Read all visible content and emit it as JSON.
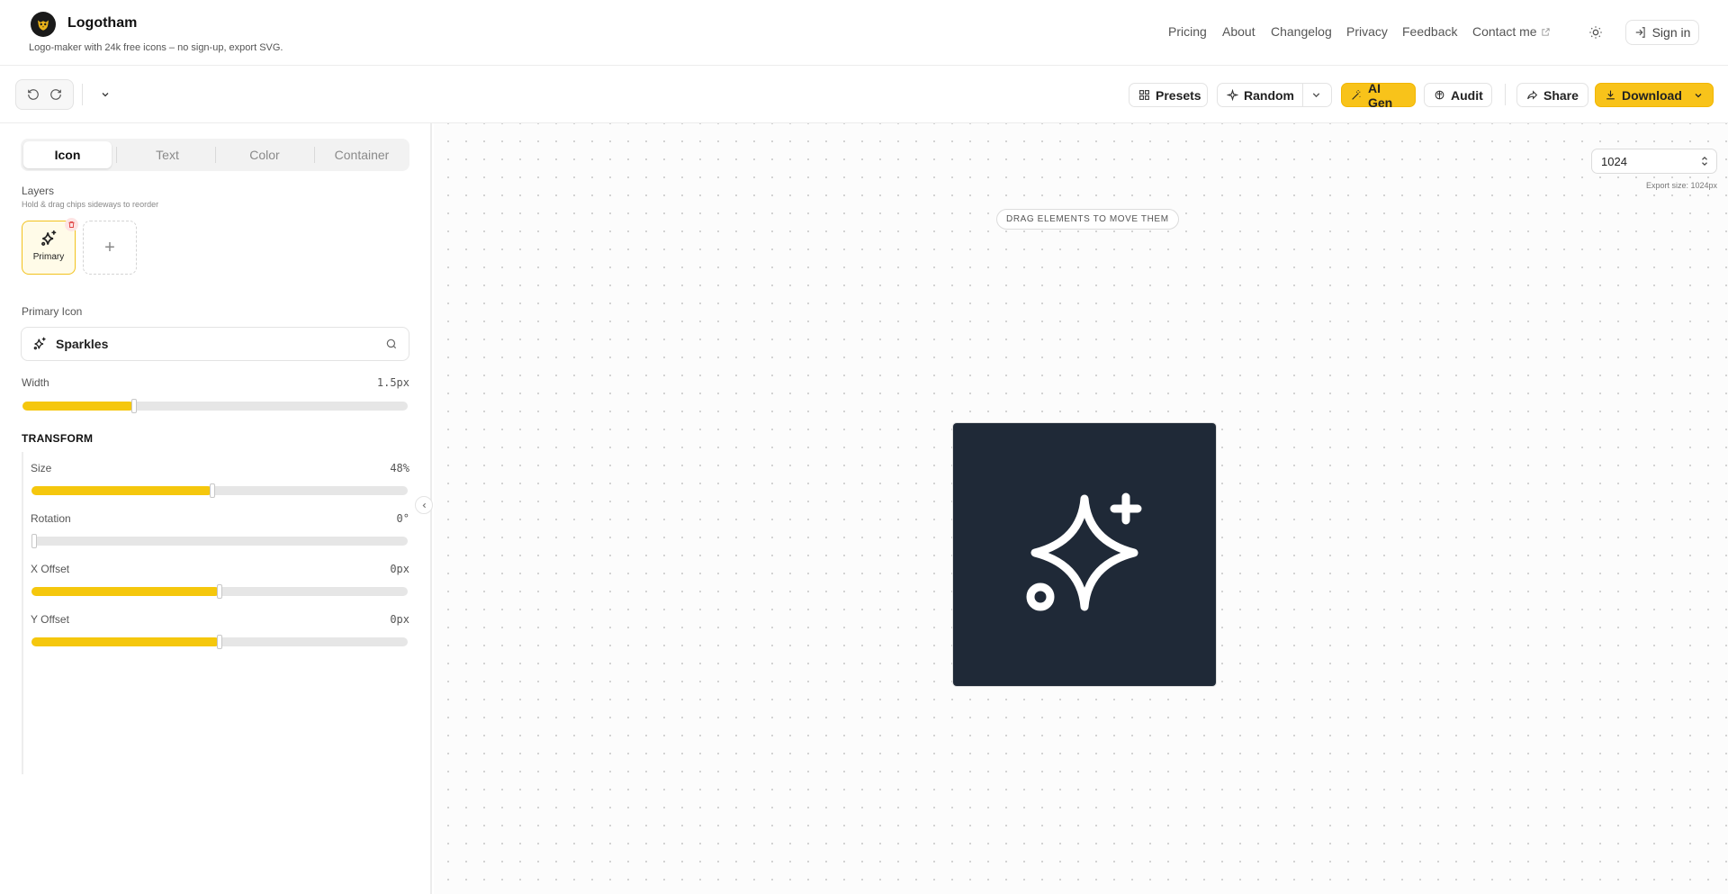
{
  "app": {
    "name": "Logotham",
    "tagline": "Logo-maker with 24k free icons – no sign-up, export SVG."
  },
  "nav": {
    "pricing": "Pricing",
    "about": "About",
    "changelog": "Changelog",
    "privacy": "Privacy",
    "feedback": "Feedback",
    "contact": "Contact me",
    "signin": "Sign in"
  },
  "toolbar": {
    "presets": "Presets",
    "random": "Random",
    "ai_gen": "AI Gen",
    "audit": "Audit",
    "share": "Share",
    "download": "Download"
  },
  "panel": {
    "tabs": [
      "Icon",
      "Text",
      "Color",
      "Container"
    ],
    "active_tab": "Icon",
    "layers_label": "Layers",
    "layers_hint": "Hold & drag chips sideways to reorder",
    "layer_chip": "Primary",
    "add_layer": "+",
    "primary_icon_label": "Primary Icon",
    "icon_value": "Sparkles",
    "width": {
      "label": "Width",
      "value": "1.5px",
      "level": 0.29
    },
    "transform_heading": "TRANSFORM",
    "size": {
      "label": "Size",
      "value": "48%",
      "level": 0.48
    },
    "rotation": {
      "label": "Rotation",
      "value": "0°",
      "level": 0.0
    },
    "x_offset": {
      "label": "X Offset",
      "value": "0px",
      "level": 0.5
    },
    "y_offset": {
      "label": "Y Offset",
      "value": "0px",
      "level": 0.5
    }
  },
  "canvas": {
    "drag_hint": "DRAG ELEMENTS TO MOVE THEM",
    "size_value": "1024",
    "export_size": "Export size: 1024px",
    "background_color": "#1f2937",
    "icon_name": "sparkles-icon",
    "icon_color": "#ffffff"
  },
  "colors": {
    "accent": "#f5c70d",
    "dark": "#1f2937"
  }
}
